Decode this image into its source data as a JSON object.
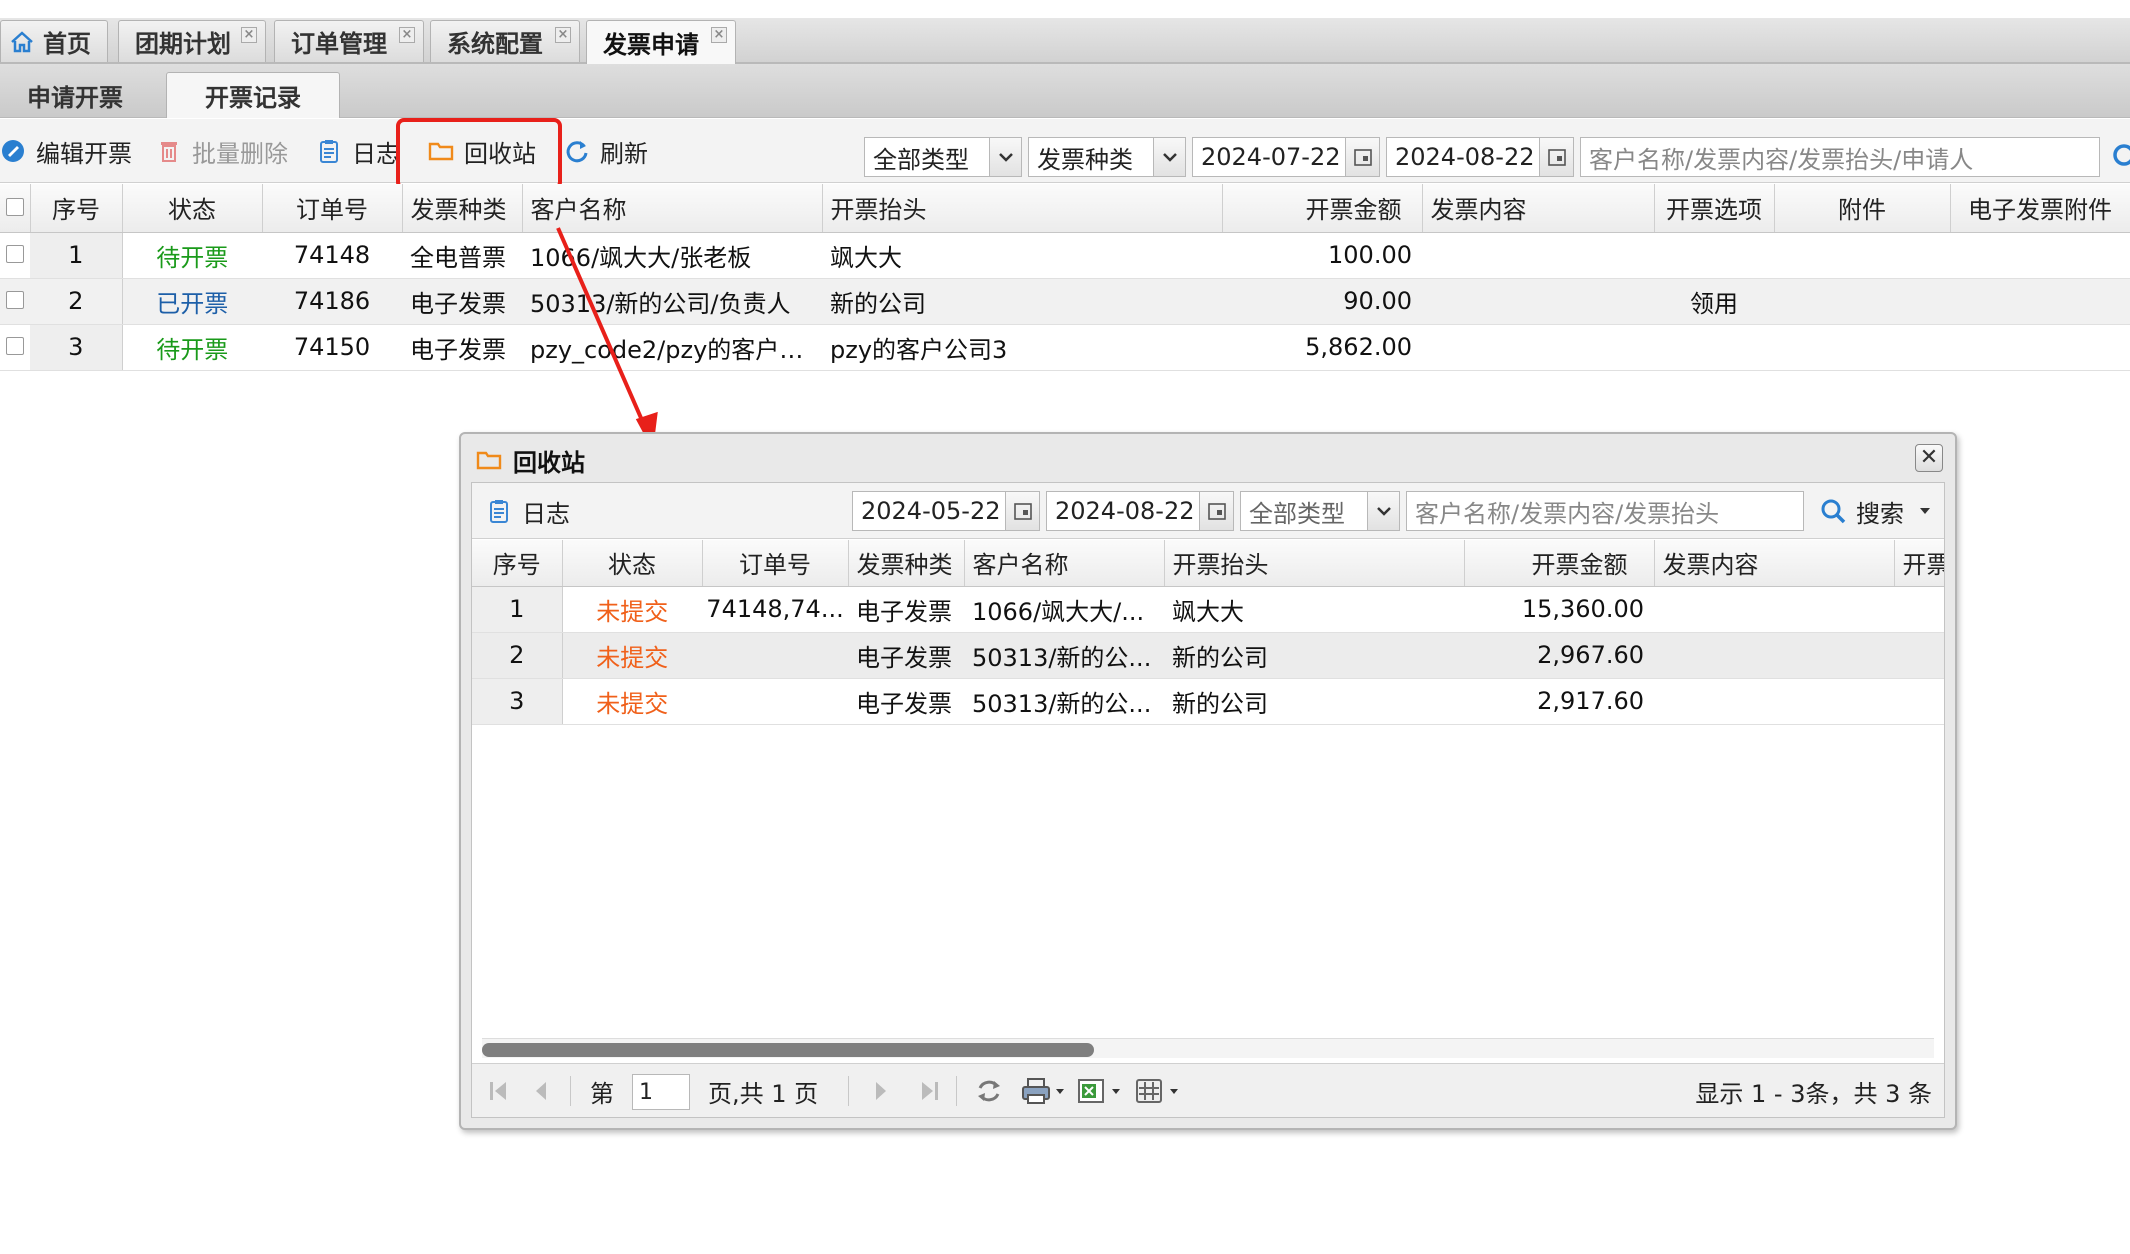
{
  "tabs": [
    {
      "label": "首页",
      "closable": false
    },
    {
      "label": "团期计划",
      "closable": true
    },
    {
      "label": "订单管理",
      "closable": true
    },
    {
      "label": "系统配置",
      "closable": true
    },
    {
      "label": "发票申请",
      "closable": true,
      "active": true
    }
  ],
  "subtabs": [
    {
      "label": "申请开票"
    },
    {
      "label": "开票记录",
      "active": true
    }
  ],
  "toolbar": {
    "edit": "编辑开票",
    "batch_delete": "批量删除",
    "log": "日志",
    "recycle": "回收站",
    "refresh": "刷新",
    "type_filter": "全部类型",
    "invoice_kind": "发票种类",
    "date_from": "2024-07-22",
    "date_to": "2024-08-22",
    "search_placeholder": "客户名称/发票内容/发票抬头/申请人"
  },
  "grid": {
    "columns": [
      "序号",
      "状态",
      "订单号",
      "发票种类",
      "客户名称",
      "开票抬头",
      "开票金额",
      "发票内容",
      "开票选项",
      "附件",
      "电子发票附件"
    ],
    "rows": [
      {
        "no": "1",
        "status": "待开票",
        "status_color": "#1a9a1a",
        "order": "74148",
        "kind": "全电普票",
        "customer": "1066/飒大大/张老板",
        "title": "飒大大",
        "amount": "100.00",
        "content": "",
        "option": "",
        "attach": "",
        "eattach": ""
      },
      {
        "no": "2",
        "status": "已开票",
        "status_color": "#1d5fa8",
        "order": "74186",
        "kind": "电子发票",
        "customer": "50313/新的公司/负责人",
        "title": "新的公司",
        "amount": "90.00",
        "content": "",
        "option": "领用",
        "attach": "",
        "eattach": ""
      },
      {
        "no": "3",
        "status": "待开票",
        "status_color": "#1a9a1a",
        "order": "74150",
        "kind": "电子发票",
        "customer": "pzy_code2/pzy的客户公...",
        "title": "pzy的客户公司3",
        "amount": "5,862.00",
        "content": "",
        "option": "",
        "attach": "",
        "eattach": ""
      }
    ]
  },
  "dialog": {
    "title": "回收站",
    "close_label": "✕",
    "toolbar": {
      "log": "日志",
      "date_from": "2024-05-22",
      "date_to": "2024-08-22",
      "type_filter": "全部类型",
      "search_placeholder": "客户名称/发票内容/发票抬头",
      "search_button": "搜索"
    },
    "columns": [
      "序号",
      "状态",
      "订单号",
      "发票种类",
      "客户名称",
      "开票抬头",
      "开票金额",
      "发票内容",
      "开票"
    ],
    "rows": [
      {
        "no": "1",
        "status": "未提交",
        "order": "74148,74...",
        "kind": "电子发票",
        "customer": "1066/飒大大/...",
        "title": "飒大大",
        "amount": "15,360.00",
        "content": ""
      },
      {
        "no": "2",
        "status": "未提交",
        "order": "",
        "kind": "电子发票",
        "customer": "50313/新的公...",
        "title": "新的公司",
        "amount": "2,967.60",
        "content": ""
      },
      {
        "no": "3",
        "status": "未提交",
        "order": "",
        "kind": "电子发票",
        "customer": "50313/新的公...",
        "title": "新的公司",
        "amount": "2,917.60",
        "content": ""
      }
    ],
    "pager": {
      "page_prefix": "第",
      "page_value": "1",
      "page_suffix": "页,共 1 页",
      "summary": "显示 1 - 3条，共 3 条"
    }
  },
  "colors": {
    "highlight": "#e8201a",
    "status_pending": "#1a9a1a",
    "status_done": "#1d5fa8",
    "status_unsubmitted": "#f0601a"
  }
}
